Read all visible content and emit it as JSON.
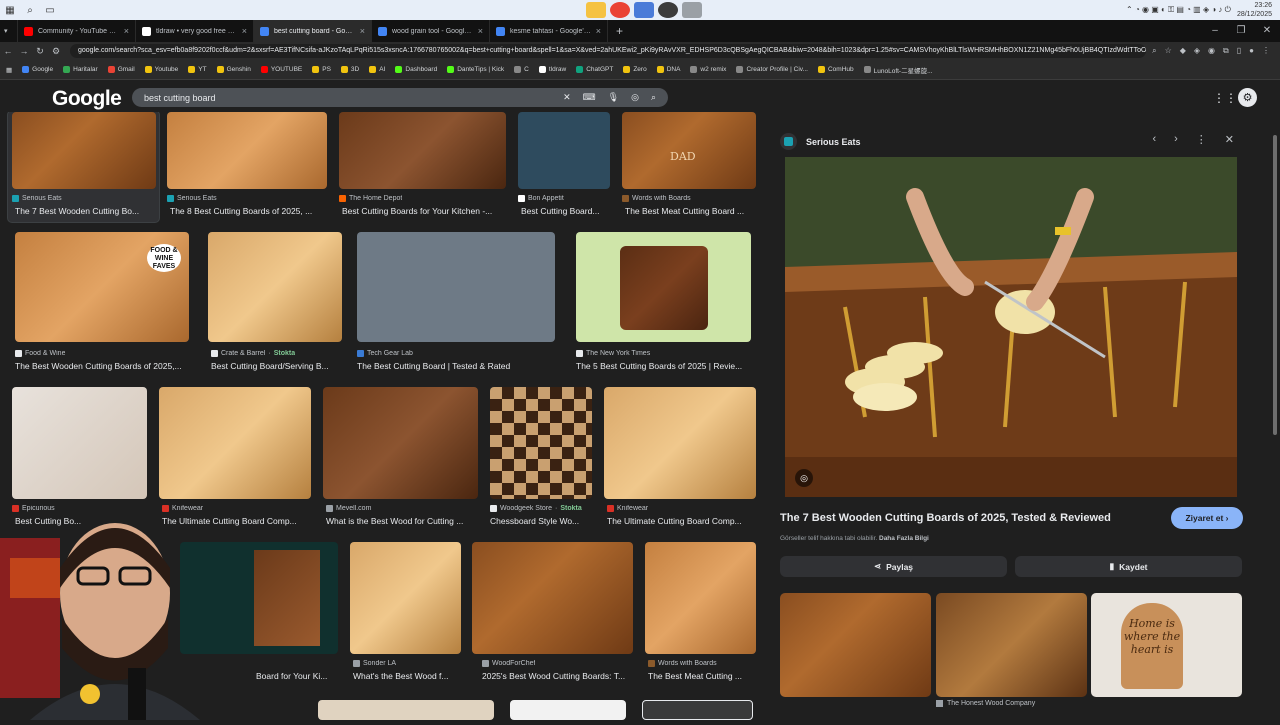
{
  "taskbar": {
    "time": "23:26",
    "date": "28/12/2025"
  },
  "tabs": [
    {
      "label": "Community - YouTube Studio",
      "color": "#ff0000"
    },
    {
      "label": "tldraw • very good free whiteb...",
      "color": "#ffffff"
    },
    {
      "label": "best cutting board - Google'da ...",
      "color": "#4285f4",
      "active": true
    },
    {
      "label": "wood grain tool - Google'da A...",
      "color": "#4285f4"
    },
    {
      "label": "kesme tahtası - Google'da Ara",
      "color": "#4285f4"
    }
  ],
  "address": {
    "url": "google.com/search?sca_esv=efb0a8f9202f0ccf&udm=2&sxsrf=AE3TifNCsifa-aJKzoTAqLPqRi515s3xsncA:1766780765002&q=best+cutting+board&spell=1&sa=X&ved=2ahUKEwi2_pKi9yRAvVXR_EDHSP6D3cQBSgAegQICBAB&biw=2048&bih=1023&dpr=1.25#sv=CAMSVhoyKhBlLTlsWHRSMHhBOXN1Z21NMg45bFh0UjBB4QTIzdWdtTToOX0Nq..."
  },
  "bookmarks": [
    "Google",
    "Haritalar",
    "Gmail",
    "Youtube",
    "YT",
    "Genshin",
    "YOUTUBE",
    "PS",
    "3D",
    "AI",
    "Dashboard",
    "DanteTips | Kick",
    "C",
    "tldraw",
    "ChatGPT",
    "Zero",
    "DNA",
    "w2 remix",
    "Creator Profile | Civ...",
    "ComHub",
    "LunoLoft-二星螺旋..."
  ],
  "search": {
    "query": "best cutting board"
  },
  "results": [
    {
      "source": "Serious Eats",
      "title": "The 7 Best Wooden Cutting Bo..."
    },
    {
      "source": "Serious Eats",
      "title": "The 8 Best Cutting Boards of 2025, ..."
    },
    {
      "source": "The Home Depot",
      "title": "Best Cutting Boards for Your Kitchen -..."
    },
    {
      "source": "Bon Appetit",
      "title": "Best Cutting Board..."
    },
    {
      "source": "Words with Boards",
      "title": "The Best Meat Cutting Board ..."
    },
    {
      "source": "Food & Wine",
      "title": "The Best Wooden Cutting Boards of 2025,..."
    },
    {
      "source": "Crate & Barrel",
      "stock": "Stokta",
      "title": "Best Cutting Board/Serving B..."
    },
    {
      "source": "Tech Gear Lab",
      "title": "The Best Cutting Board | Tested & Rated"
    },
    {
      "source": "The New York Times",
      "title": "The 5 Best Cutting Boards of 2025 | Revie..."
    },
    {
      "source": "Epicurious",
      "title": "Best Cutting Bo..."
    },
    {
      "source": "Knifewear",
      "title": "The Ultimate Cutting Board Comp..."
    },
    {
      "source": "Mevell.com",
      "title": "What is the Best Wood for Cutting ..."
    },
    {
      "source": "Woodgeek Store",
      "stock": "Stokta",
      "title": "Chessboard Style Wo..."
    },
    {
      "source": "Knifewear",
      "title": "The Ultimate Cutting Board Comp..."
    },
    {
      "source": "",
      "title": "Board for Your Ki..."
    },
    {
      "source": "Sonder LA",
      "title": "What's the Best Wood f..."
    },
    {
      "source": "WoodForChef",
      "title": "2025's Best Wood Cutting Boards: T..."
    },
    {
      "source": "Words with Boards",
      "title": "The Best Meat Cutting ..."
    }
  ],
  "thumb_badges": {
    "food_wine": "FOOD & WINE FAVES",
    "dad": "DAD"
  },
  "detail": {
    "source": "Serious Eats",
    "title": "The 7 Best Wooden Cutting Boards of 2025, Tested & Reviewed",
    "visit_label": "Ziyaret et",
    "copyright": "Görseller telif hakkına tabi olabilir.",
    "more_info": "Daha Fazla Bilgi",
    "share_label": "Paylaş",
    "save_label": "Kaydet",
    "related_source": "The Honest Wood Company",
    "related_sign": "Home is where the heart is"
  },
  "colors": {
    "accent": "#8ab4f8",
    "bg": "#1f1f1f",
    "stock": "#81c995"
  }
}
